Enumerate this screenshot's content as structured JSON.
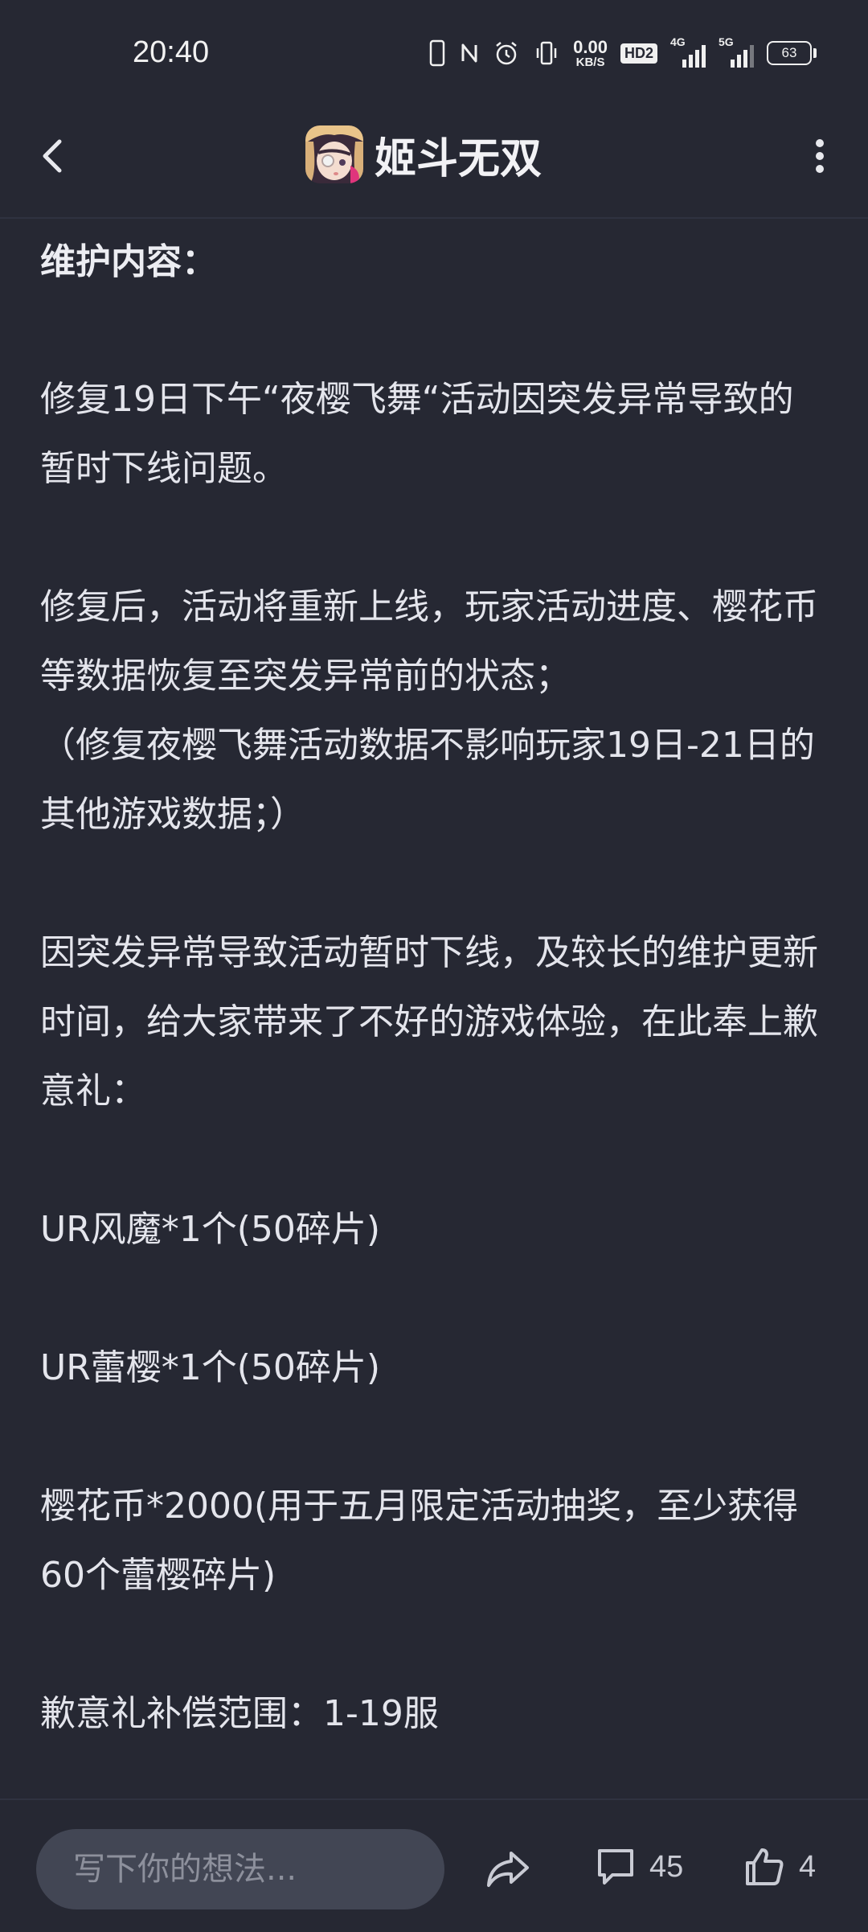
{
  "status_bar": {
    "time": "20:40",
    "net_speed_value": "0.00",
    "net_speed_unit": "KB/S",
    "hd_badge": "HD2",
    "signal1_label": "4G",
    "signal2_label": "5G",
    "battery": "63",
    "icons": [
      "phone-icon",
      "nfc-icon",
      "alarm-icon",
      "vibrate-icon",
      "hd-icon",
      "signal-4g-icon",
      "signal-5g-icon",
      "battery-icon"
    ]
  },
  "nav": {
    "title": "姬斗无双",
    "back_icon": "chevron-left-icon",
    "more_icon": "more-vertical-icon"
  },
  "article": {
    "heading": "维护内容：",
    "paragraphs": [
      "修复19日下午“夜樱飞舞“活动因突发异常导致的暂时下线问题。",
      "修复后，活动将重新上线，玩家活动进度、樱花币等数据恢复至突发异常前的状态；",
      "（修复夜樱飞舞活动数据不影响玩家19日-21日的其他游戏数据；）",
      "因突发异常导致活动暂时下线，及较长的维护更新时间，给大家带来了不好的游戏体验，在此奉上歉意礼：",
      "UR风魔*1个(50碎片)",
      "UR蕾樱*1个(50碎片)",
      "樱花币*2000(用于五月限定活动抽奖，至少获得60个蕾樱碎片)",
      "歉意礼补偿范围：1-19服"
    ]
  },
  "bottom_bar": {
    "comment_placeholder": "写下你的想法...",
    "comment_count": "45",
    "like_count": "4"
  },
  "colors": {
    "background": "#262833",
    "text": "#e4e5ec",
    "input_bg": "#424654"
  }
}
